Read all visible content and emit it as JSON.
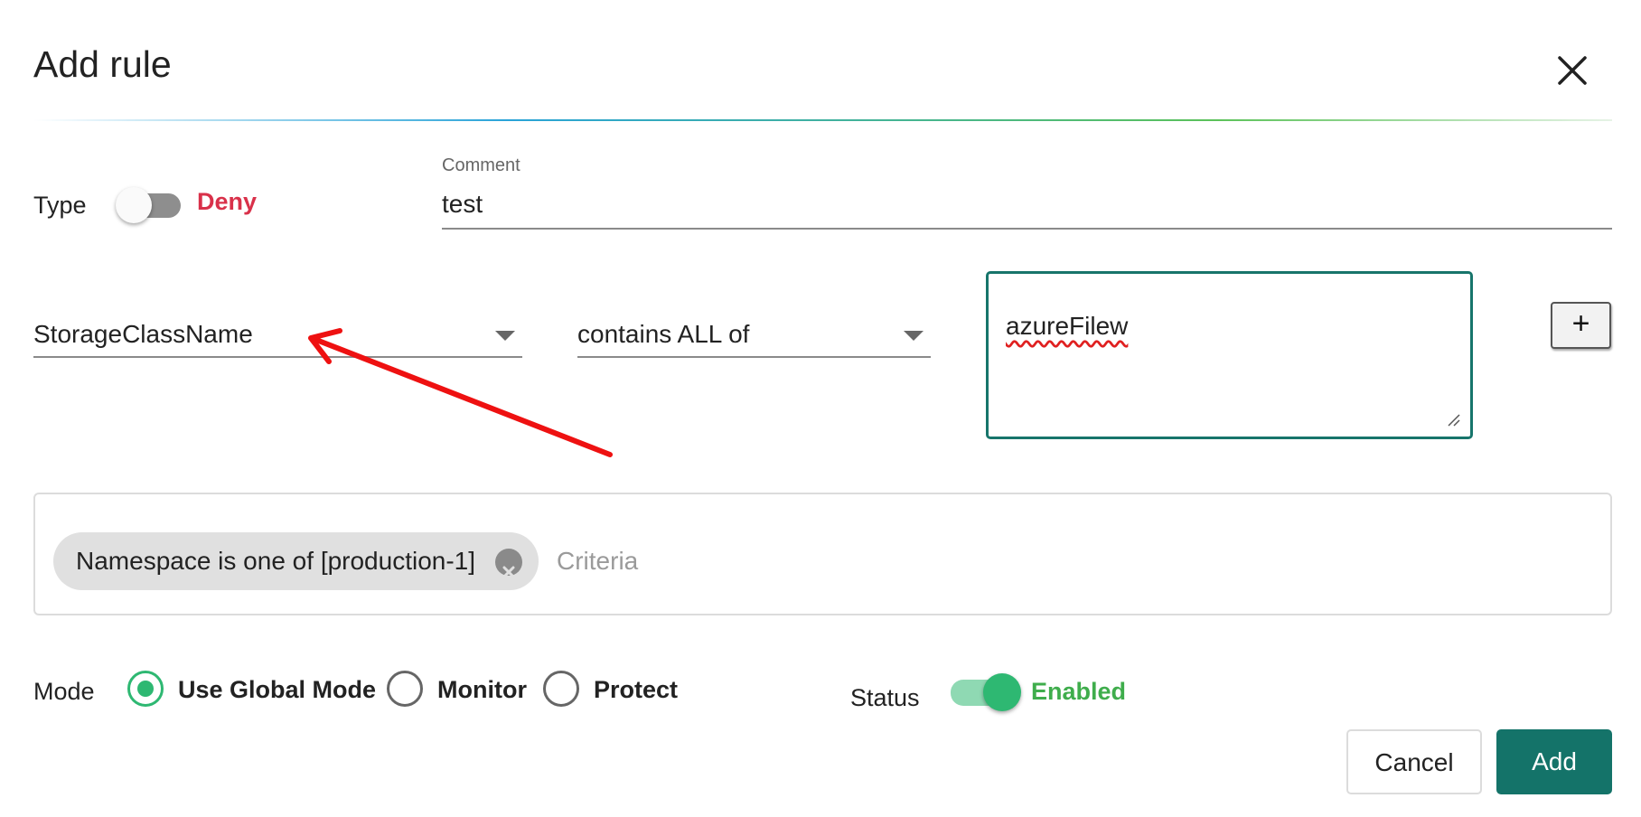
{
  "dialog": {
    "title": "Add rule"
  },
  "type": {
    "label": "Type",
    "toggle_state": "off",
    "value_text": "Deny",
    "value_color": "#d9314a"
  },
  "comment": {
    "label": "Comment",
    "value": "test"
  },
  "rule": {
    "field_select": {
      "value": "StorageClassName"
    },
    "operator_select": {
      "value": "contains ALL of"
    },
    "value_input": {
      "value": "azureFilew",
      "spellcheck_error": true
    },
    "add_button_label": "+"
  },
  "criteria": {
    "chips": [
      {
        "label": "Namespace is one of [production-1]"
      }
    ],
    "placeholder": "Criteria"
  },
  "mode": {
    "label": "Mode",
    "options": [
      {
        "label": "Use Global Mode",
        "selected": true
      },
      {
        "label": "Monitor",
        "selected": false
      },
      {
        "label": "Protect",
        "selected": false
      }
    ]
  },
  "status": {
    "label": "Status",
    "toggle_state": "on",
    "value_text": "Enabled",
    "value_color": "#3fad4c"
  },
  "actions": {
    "cancel_label": "Cancel",
    "add_label": "Add",
    "primary_color": "#147369"
  },
  "annotation": {
    "type": "red-arrow",
    "points_to": "field-select",
    "color": "#ee1111"
  }
}
